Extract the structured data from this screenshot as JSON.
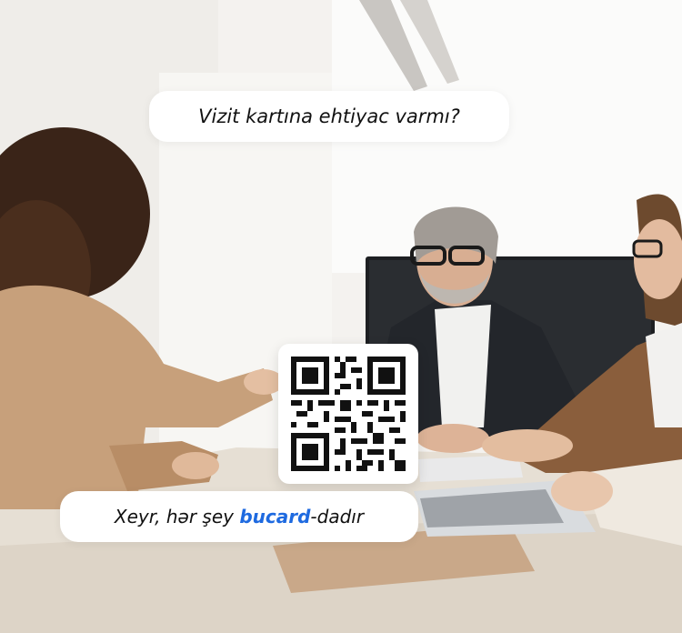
{
  "question_bubble": {
    "text": "Vizit kartına ehtiyac varmı?"
  },
  "answer_bubble": {
    "prefix": "Xeyr, hər şey ",
    "brand": "bucard",
    "suffix": "-dadır"
  },
  "colors": {
    "brand": "#1e6ae0",
    "bubble_bg": "#ffffff",
    "text": "#111111"
  },
  "qr_code": {
    "icon": "qr-code-icon"
  }
}
